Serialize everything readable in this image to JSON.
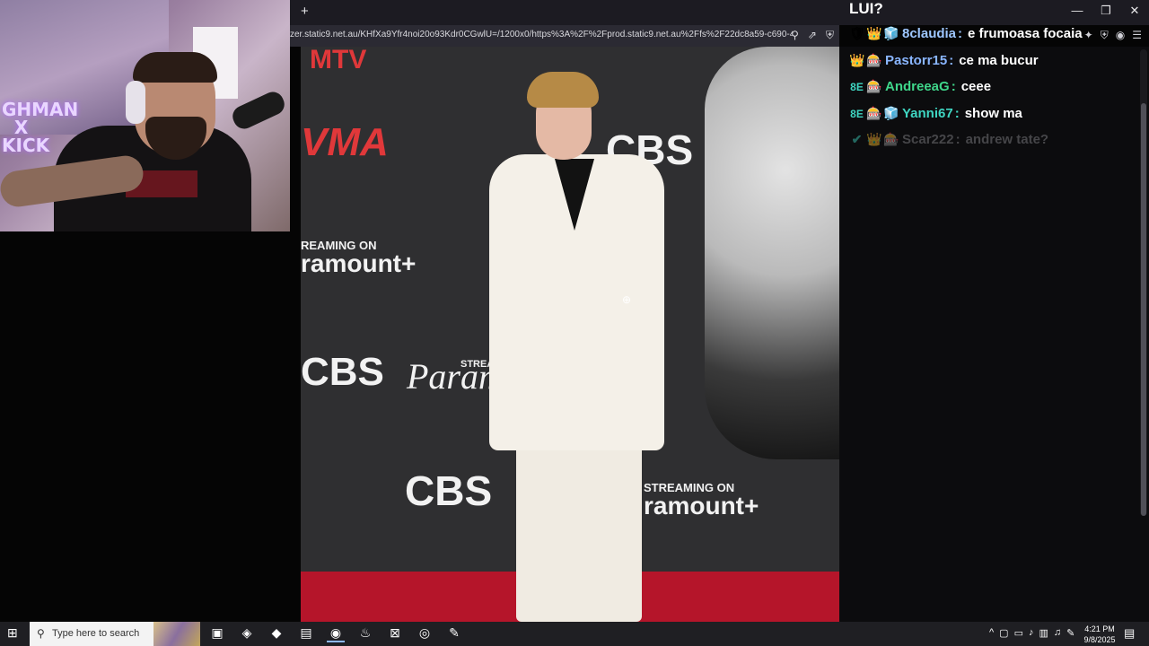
{
  "webcam": {
    "poster_text": "GHMAN\n  X\nKICK"
  },
  "browser": {
    "new_tab_label": "+",
    "window_controls": {
      "minimize": "—",
      "restore": "❐",
      "close": "✕"
    },
    "url": "zer.static9.net.au/KHfXa9Yfr4noi20o93Kdr0CGwlU=/1200x0/https%3A%2F%2Fprod.static9.net.au%2Ffs%2F22dc8a59-c690-4144-8588...",
    "url_icons": {
      "zoom": "⚲",
      "share": "⇗",
      "shield": "⛨"
    },
    "toolbar_icons": {
      "extension": "✦",
      "shield": "⛨",
      "profile": "◉",
      "menu": "☰"
    }
  },
  "viewer": {
    "backdrop": {
      "vma": "VMA",
      "mtv": "MTV",
      "cbs_top": "CBS",
      "streaming_on_left": "REAMING ON",
      "paramount_left": "ramount+",
      "cbs_left": "CBS",
      "stream_mid": "STREA",
      "paramount_mid": "Paramo",
      "cbs_bottom": "CBS",
      "streaming_on_right": "STREAMING ON",
      "paramount_right": "ramount+"
    },
    "cursor_icon": "zoom-in"
  },
  "chat": {
    "header": "LUI?",
    "messages": [
      {
        "badges": [
          "🛡",
          "👑",
          "🧊"
        ],
        "user": "8claudia",
        "text": "e frumoasa focaia",
        "color": "#9ec7ff",
        "faded": false
      },
      {
        "badges": [
          "👑",
          "🎰"
        ],
        "user": "Pastorr15",
        "text": "ce ma bucur",
        "color": "#8ab6ff",
        "faded": false
      },
      {
        "badges": [
          "8E",
          "🎰"
        ],
        "user": "AndreeaG",
        "text": "ceee",
        "color": "#3fd68a",
        "faded": false
      },
      {
        "badges": [
          "8E",
          "🎰",
          "🧊"
        ],
        "user": "Yanni67",
        "text": "show ma",
        "color": "#3fd6c2",
        "faded": false
      },
      {
        "badges": [
          "✔",
          "👑",
          "🎰"
        ],
        "user": "Scar222",
        "text": "andrew tate?",
        "color": "#8a8a90",
        "faded": true
      }
    ]
  },
  "taskbar": {
    "start_icon": "⊞",
    "search_placeholder": "Type here to search",
    "apps": [
      "▣",
      "◈",
      "◆",
      "▤",
      "◉",
      "♨",
      "⊠",
      "◎",
      "✎"
    ],
    "tray_icons": [
      "^",
      "▢",
      "▭",
      "♪",
      "▥",
      "♫",
      "✎"
    ],
    "time": "4:21 PM",
    "date": "9/8/2025",
    "notification_icon": "▤"
  }
}
